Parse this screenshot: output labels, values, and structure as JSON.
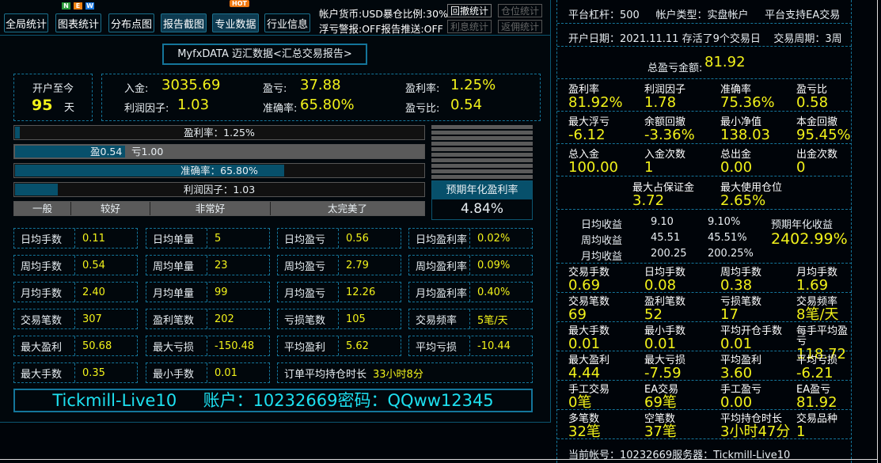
{
  "nav": [
    "全局统计",
    "图表统计",
    "分布点图",
    "报告截图",
    "专业数据",
    "行业信息"
  ],
  "badges": {
    "new": [
      "N",
      "E",
      "W"
    ],
    "hot": "HOT"
  },
  "info": {
    "line1": "帐户货币:USD暴仓比例:30%",
    "line2": "浮亏警报:OFF报告推送:OFF"
  },
  "small_buttons": [
    "回撤统计",
    "仓位统计",
    "利息统计",
    "返佣统计"
  ],
  "title": "MyfxDATA 迈汇数据<汇总交易报告>",
  "opened": {
    "label": "开户至今",
    "days": "95",
    "unit": "天"
  },
  "summary": [
    {
      "k": "入金:",
      "v": "3035.69"
    },
    {
      "k": "盈亏:",
      "v": "37.88"
    },
    {
      "k": "盈利率:",
      "v": "1.25%"
    },
    {
      "k": "利润因子:",
      "v": "1.03"
    },
    {
      "k": "准确率:",
      "v": "65.80%"
    },
    {
      "k": "盈亏比:",
      "v": "0.54"
    }
  ],
  "bars": [
    {
      "label": "盈利率：1.25%",
      "fill": 1.25
    },
    {
      "label_win": "盈0.54",
      "label_loss": "亏1.00",
      "fill": 27
    },
    {
      "label": "准确率：65.80%",
      "fill": 65.8
    },
    {
      "label": "利润因子：1.03",
      "fill": 10.5
    }
  ],
  "ratings": [
    "一般",
    "较好",
    "非常好",
    "太完美了"
  ],
  "annual": {
    "label": "预期年化盈利率",
    "value": "4.84%"
  },
  "grid": [
    [
      [
        "日均手数",
        "0.11"
      ],
      [
        "日均单量",
        "5"
      ],
      [
        "日均盈亏",
        "0.56"
      ],
      [
        "日均盈利率",
        "0.02%"
      ]
    ],
    [
      [
        "周均手数",
        "0.54"
      ],
      [
        "周均单量",
        "23"
      ],
      [
        "周均盈亏",
        "2.79"
      ],
      [
        "周均盈利率",
        "0.09%"
      ]
    ],
    [
      [
        "月均手数",
        "2.40"
      ],
      [
        "月均单量",
        "99"
      ],
      [
        "月均盈亏",
        "12.26"
      ],
      [
        "月均盈利率",
        "0.40%"
      ]
    ],
    [
      [
        "交易笔数",
        "307"
      ],
      [
        "盈利笔数",
        "202"
      ],
      [
        "亏损笔数",
        "105"
      ],
      [
        "交易频率",
        "5笔/天"
      ]
    ],
    [
      [
        "最大盈利",
        "50.68"
      ],
      [
        "最大亏损",
        "-150.48"
      ],
      [
        "平均盈利",
        "5.62"
      ],
      [
        "平均亏损",
        "-10.44"
      ]
    ],
    [
      [
        "最大手数",
        "0.35"
      ],
      [
        "最小手数",
        "0.01"
      ]
    ]
  ],
  "hold": {
    "label": "订单平均持仓时长",
    "value": "33小时8分"
  },
  "account_banner": "Tickmill-Live10     账户：10232669密码：QQww12345",
  "right": {
    "line1": "平台杠杆：500     帐户类型：实盘帐户     平台支持EA交易",
    "line2": "开户日期：2021.11.11 存活了9个交易日    交易周期：3周",
    "total_label": "总盈亏金额:",
    "total_value": "81.92",
    "rows1": [
      [
        [
          "盈利率",
          "81.92%"
        ],
        [
          "利润因子",
          "1.78"
        ],
        [
          "准确率",
          "75.36%"
        ],
        [
          "盈亏比",
          "0.58"
        ]
      ],
      [
        [
          "最大浮亏",
          "-6.12"
        ],
        [
          "余额回撤",
          "-3.36%"
        ],
        [
          "最小净值",
          "138.03"
        ],
        [
          "本金回撤",
          "95.45%"
        ]
      ],
      [
        [
          "总入金",
          "100.00"
        ],
        [
          "入金次数",
          "1"
        ],
        [
          "总出金",
          "0.00"
        ],
        [
          "出金次数",
          "0"
        ]
      ]
    ],
    "margin": [
      [
        "最大占保证金",
        "3.72"
      ],
      [
        "最大使用仓位",
        "2.65%"
      ]
    ],
    "avg": [
      [
        "日均收益",
        "9.10",
        "9.10%"
      ],
      [
        "周均收益",
        "45.51",
        "45.51%"
      ],
      [
        "月均收益",
        "200.25",
        "200.25%"
      ]
    ],
    "annual_label": "预期年化收益",
    "annual_value": "2402.99%",
    "rows2": [
      [
        [
          "交易手数",
          "0.69"
        ],
        [
          "日均手数",
          "0.08"
        ],
        [
          "周均手数",
          "0.38"
        ],
        [
          "月均手数",
          "1.69"
        ]
      ],
      [
        [
          "交易笔数",
          "69"
        ],
        [
          "盈利笔数",
          "52"
        ],
        [
          "亏损笔数",
          "17"
        ],
        [
          "交易频率",
          "8笔/天"
        ]
      ],
      [
        [
          "最大手数",
          "0.01"
        ],
        [
          "最小手数",
          "0.01"
        ],
        [
          "平均开仓手数",
          "0.01"
        ],
        [
          "每手平均盈亏",
          "118.72"
        ]
      ],
      [
        [
          "最大盈利",
          "4.44"
        ],
        [
          "最大亏损",
          "-7.59"
        ],
        [
          "平均盈利",
          "3.60"
        ],
        [
          "平均亏损",
          "-6.21"
        ]
      ],
      [
        [
          "手工交易",
          "0笔"
        ],
        [
          "EA交易",
          "69笔"
        ],
        [
          "手工盈亏",
          "0.00"
        ],
        [
          "EA盈亏",
          "81.92"
        ]
      ],
      [
        [
          "多笔数",
          "32笔"
        ],
        [
          "空笔数",
          "37笔"
        ],
        [
          "平均持仓时长",
          "3小时47分"
        ],
        [
          "交易品种",
          "1"
        ]
      ]
    ],
    "footer": "当前帐号：10232669服务器：Tickmill-Live10"
  }
}
